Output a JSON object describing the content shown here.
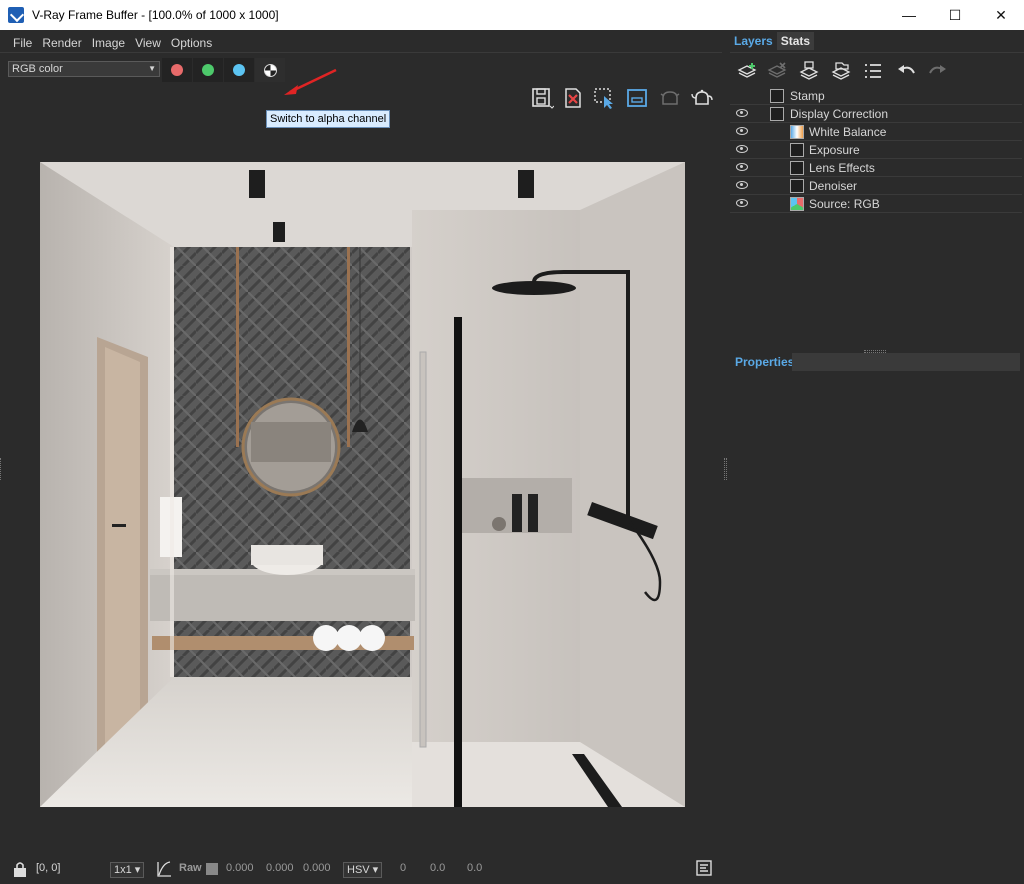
{
  "window": {
    "title": "V-Ray Frame Buffer - [100.0% of 1000 x 1000]",
    "minimize_glyph": "—",
    "maximize_glyph": "☐",
    "close_glyph": "✕"
  },
  "menu": {
    "items": [
      "File",
      "Render",
      "Image",
      "View",
      "Options"
    ]
  },
  "toolbar": {
    "channel_value": "RGB color",
    "channel_colors": {
      "red": "#e86b6b",
      "green": "#4dc96b",
      "blue": "#5cc4f2"
    },
    "tooltip": "Switch to alpha channel",
    "arrow_color": "#e02424",
    "right_icons": [
      "save-icon",
      "clear-image-icon",
      "region-render-icon",
      "track-mouse-icon",
      "render-last-icon",
      "render-teapot-icon"
    ]
  },
  "statusbar": {
    "coords": "[0, 0]",
    "sample_size": "1x1",
    "raw_label": "Raw",
    "rgb_values": [
      "0.000",
      "0.000",
      "0.000"
    ],
    "color_space": "HSV",
    "hsv_values": [
      "0",
      "0.0",
      "0.0"
    ]
  },
  "right_panel": {
    "tabs": [
      "Layers",
      "Stats"
    ],
    "layers": [
      {
        "label": "Stamp",
        "visible_toggle": false,
        "indent": 1,
        "icon": "stamp-icon"
      },
      {
        "label": "Display Correction",
        "visible_toggle": true,
        "indent": 1,
        "icon": "curve-icon"
      },
      {
        "label": "White Balance",
        "visible_toggle": true,
        "indent": 2,
        "icon": "white-balance-icon"
      },
      {
        "label": "Exposure",
        "visible_toggle": true,
        "indent": 2,
        "icon": "exposure-icon"
      },
      {
        "label": "Lens Effects",
        "visible_toggle": true,
        "indent": 2,
        "icon": "lens-effects-icon"
      },
      {
        "label": "Denoiser",
        "visible_toggle": true,
        "indent": 2,
        "icon": "denoiser-icon"
      },
      {
        "label": "Source: RGB",
        "visible_toggle": true,
        "indent": 2,
        "icon": "source-rgb-icon"
      }
    ],
    "properties_label": "Properties"
  },
  "colors": {
    "background": "#2b2b2b",
    "accent": "#5aa9e6"
  }
}
